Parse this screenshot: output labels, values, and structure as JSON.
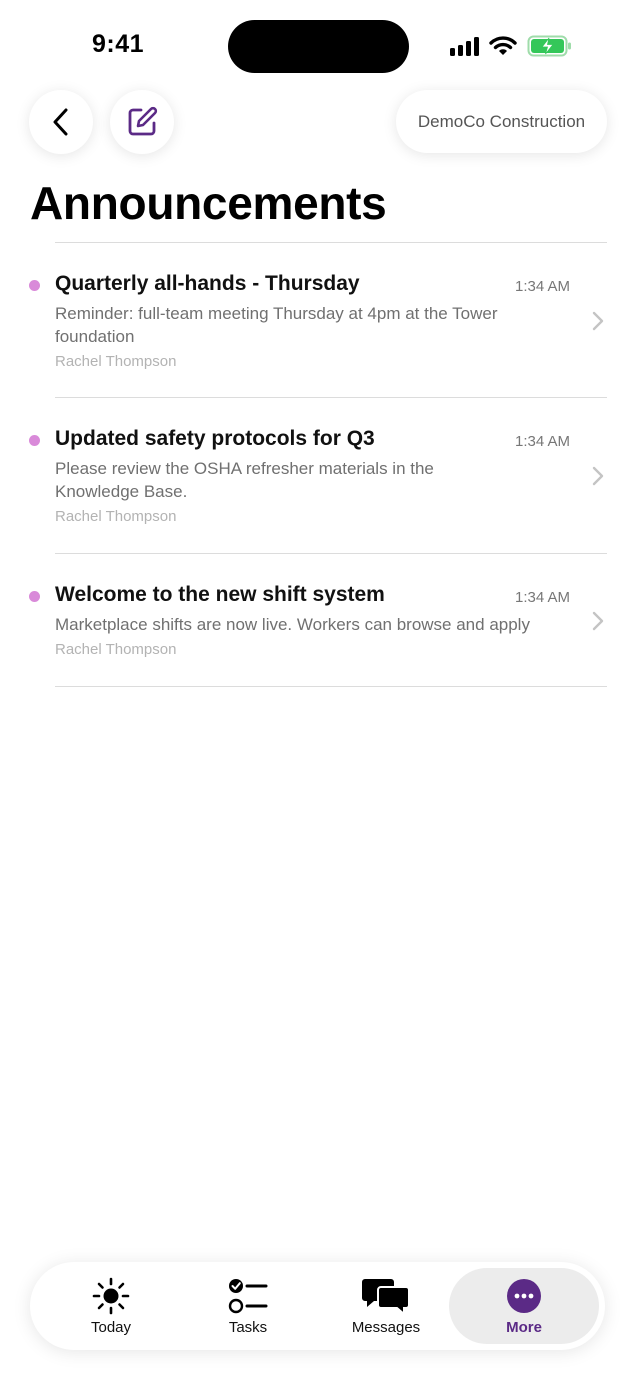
{
  "status_bar": {
    "time": "9:41"
  },
  "header": {
    "company": "DemoCo Construction",
    "title": "Announcements"
  },
  "announcements": [
    {
      "title": "Quarterly all-hands - Thursday",
      "time": "1:34 AM",
      "body": "Reminder: full-team meeting Thursday at 4pm at the Tower foundation",
      "author": "Rachel Thompson"
    },
    {
      "title": "Updated safety protocols for Q3",
      "time": "1:34 AM",
      "body": "Please review the OSHA refresher materials in the Knowledge Base.",
      "author": "Rachel Thompson"
    },
    {
      "title": "Welcome to the new shift system",
      "time": "1:34 AM",
      "body": "Marketplace shifts are now live. Workers can browse and apply",
      "author": "Rachel Thompson"
    }
  ],
  "tabbar": {
    "tabs": [
      {
        "label": "Today",
        "icon": "sun-icon"
      },
      {
        "label": "Tasks",
        "icon": "checklist-icon"
      },
      {
        "label": "Messages",
        "icon": "chat-bubbles-icon"
      },
      {
        "label": "More",
        "icon": "more-dots-icon"
      }
    ],
    "active_tab": "More"
  },
  "colors": {
    "accent": "#5b2a86",
    "unread_dot": "#d98ad9",
    "battery": "#34c759"
  }
}
